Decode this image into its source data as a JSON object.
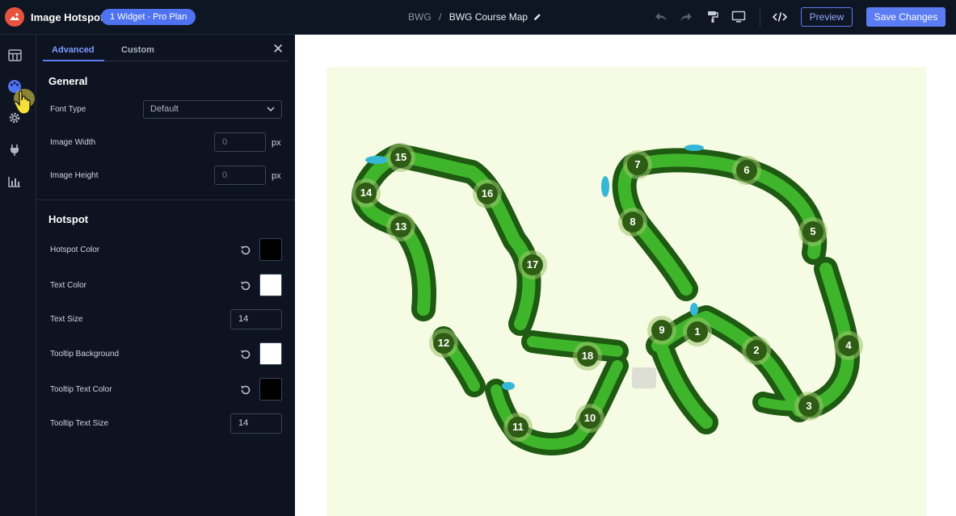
{
  "topbar": {
    "app_title": "Image Hotspot",
    "plan_badge": "1 Widget - Pro Plan",
    "breadcrumb_root": "BWG",
    "breadcrumb_sep": "/",
    "breadcrumb_current": "BWG Course Map",
    "preview_label": "Preview",
    "save_label": "Save Changes",
    "accent_color": "#5b7cf2"
  },
  "rail": {
    "icons": [
      "layout-icon",
      "palette-icon",
      "gear-icon",
      "plug-icon",
      "chart-icon"
    ]
  },
  "panel": {
    "tabs": {
      "advanced": "Advanced",
      "custom": "Custom"
    },
    "close": "✕",
    "general": {
      "title": "General",
      "font_type_label": "Font Type",
      "font_type_value": "Default",
      "image_width_label": "Image Width",
      "image_width_placeholder": "0",
      "image_height_label": "Image Height",
      "image_height_placeholder": "0",
      "unit": "px"
    },
    "hotspot": {
      "title": "Hotspot",
      "hotspot_color_label": "Hotspot Color",
      "hotspot_color": "#000000",
      "text_color_label": "Text Color",
      "text_color": "#ffffff",
      "text_size_label": "Text Size",
      "text_size_value": "14",
      "tooltip_bg_label": "Tooltip Background",
      "tooltip_bg": "#ffffff",
      "tooltip_text_color_label": "Tooltip Text Color",
      "tooltip_text_color": "#000000",
      "tooltip_text_size_label": "Tooltip Text Size",
      "tooltip_text_size_value": "14"
    }
  },
  "map": {
    "hotspots": [
      "15",
      "14",
      "16",
      "13",
      "17",
      "7",
      "6",
      "8",
      "5",
      "9",
      "1",
      "12",
      "18",
      "2",
      "4",
      "3",
      "11",
      "10"
    ]
  }
}
